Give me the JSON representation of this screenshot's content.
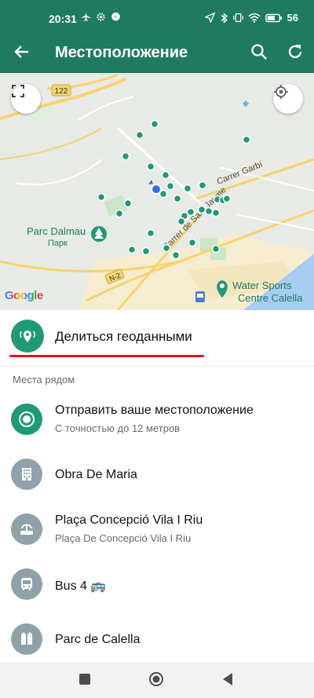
{
  "status_bar": {
    "time": "20:31",
    "battery": "56"
  },
  "app_bar": {
    "title": "Местоположение"
  },
  "map": {
    "road_shield": "122",
    "road_name_1": "Carrer Garbí",
    "road_name_2": "Carrer de Sant Jaume",
    "road_shield_2": "N-2",
    "park_name": "Parc Dalmau",
    "park_type": "Парк",
    "poi_name_line1": "Water Sports",
    "poi_name_line2": "Centre Calella",
    "logo": "Google"
  },
  "share_live": {
    "label": "Делиться геоданными"
  },
  "nearby": {
    "header": "Места рядом",
    "items": [
      {
        "name": "Отправить ваше местоположение",
        "subtitle": "С точностью до 12 метров",
        "icon": "current-location-icon"
      },
      {
        "name": "Obra De Maria",
        "subtitle": "",
        "icon": "building-icon"
      },
      {
        "name": "Plaça Concepció Vila I Riu",
        "subtitle": "Plaça De Concepció Vila I Riu",
        "icon": "fountain-icon"
      },
      {
        "name": "Bus 4 🚌",
        "subtitle": "",
        "icon": "bus-icon"
      },
      {
        "name": "Parc de Calella",
        "subtitle": "",
        "icon": "park-icon"
      }
    ]
  },
  "colors": {
    "brand": "#1f7b5f",
    "accent": "#1f9a76",
    "underline": "#e0161d",
    "place_icon_bg": "#8fa2aa"
  }
}
